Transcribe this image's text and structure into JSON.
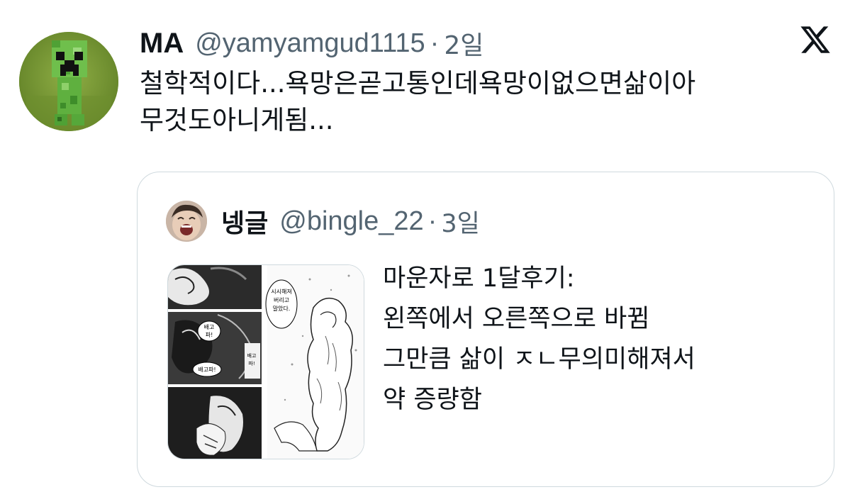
{
  "tweet": {
    "author_name": "MA",
    "author_handle": "@yamyamgud1115",
    "separator": "·",
    "time": "2일",
    "text": "철학적이다...욕망은곧고통인데욕망이없으면삶이아\n무것도아니게됨...",
    "avatar_icon": "creeper-avatar-icon",
    "logo_icon": "x-logo-icon"
  },
  "quote": {
    "author_name": "넹글",
    "author_handle": "@bingle_22",
    "separator": "·",
    "time": "3일",
    "text": "마운자로 1달후기:\n왼쪽에서 오른쪽으로 바뀜\n그만큼 삶이 ㅈㄴ무의미해져서\n약 증량함",
    "avatar_icon": "laughing-face-avatar-icon",
    "media": {
      "left_panel_bubbles": [
        "배고\n파!",
        "배고파!",
        "배고\n파!"
      ],
      "right_panel_bubble": "시시해져\n버리고\n말았다."
    }
  },
  "colors": {
    "text_primary": "#0f1419",
    "text_secondary": "#536471",
    "border": "#cfd9de",
    "background": "#ffffff"
  }
}
